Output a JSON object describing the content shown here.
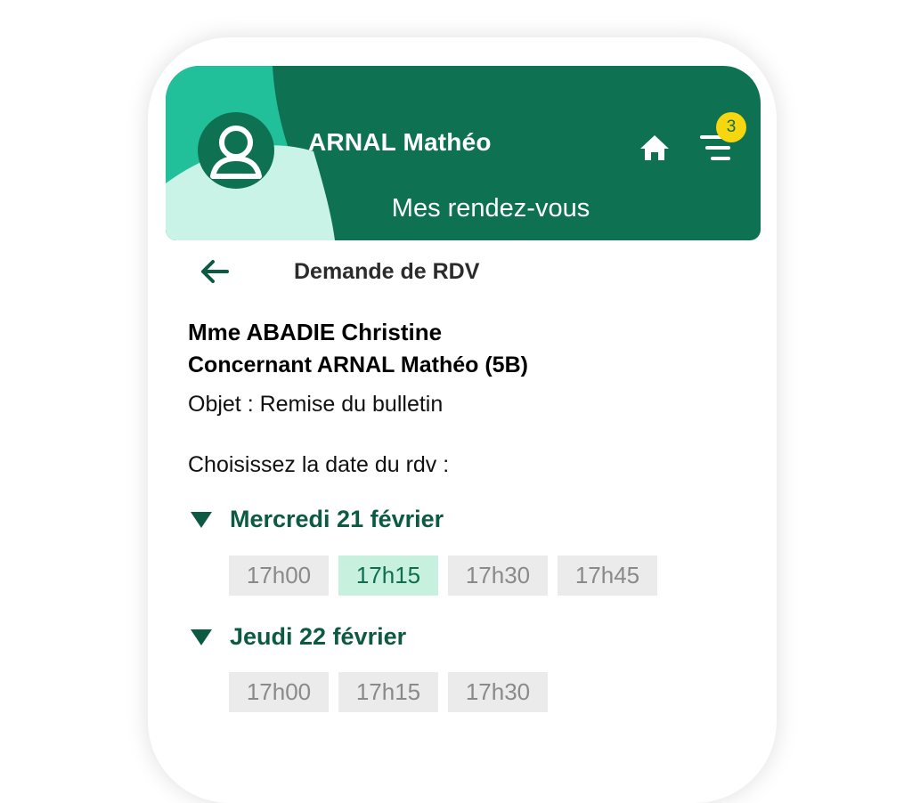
{
  "header": {
    "user_name": "ARNAL Mathéo",
    "section_title": "Mes rendez-vous",
    "notification_count": "3",
    "colors": {
      "dark_green": "#0e7152",
      "teal": "#21c09b",
      "mint": "#c9f3e6",
      "badge": "#f6d60e"
    }
  },
  "page": {
    "title": "Demande de RDV",
    "teacher": "Mme ABADIE Christine",
    "concerning": "Concernant ARNAL Mathéo (5B)",
    "subject": "Objet : Remise du bulletin",
    "prompt": "Choisissez la date du rdv :"
  },
  "days": [
    {
      "label": "Mercredi 21 février",
      "slots": [
        "17h00",
        "17h15",
        "17h30",
        "17h45"
      ],
      "selected_index": 1
    },
    {
      "label": "Jeudi 22 février",
      "slots": [
        "17h00",
        "17h15",
        "17h30"
      ],
      "selected_index": -1
    }
  ],
  "icons": [
    "avatar-icon",
    "home-icon",
    "menu-icon",
    "back-arrow-icon",
    "expand-triangle-icon"
  ]
}
